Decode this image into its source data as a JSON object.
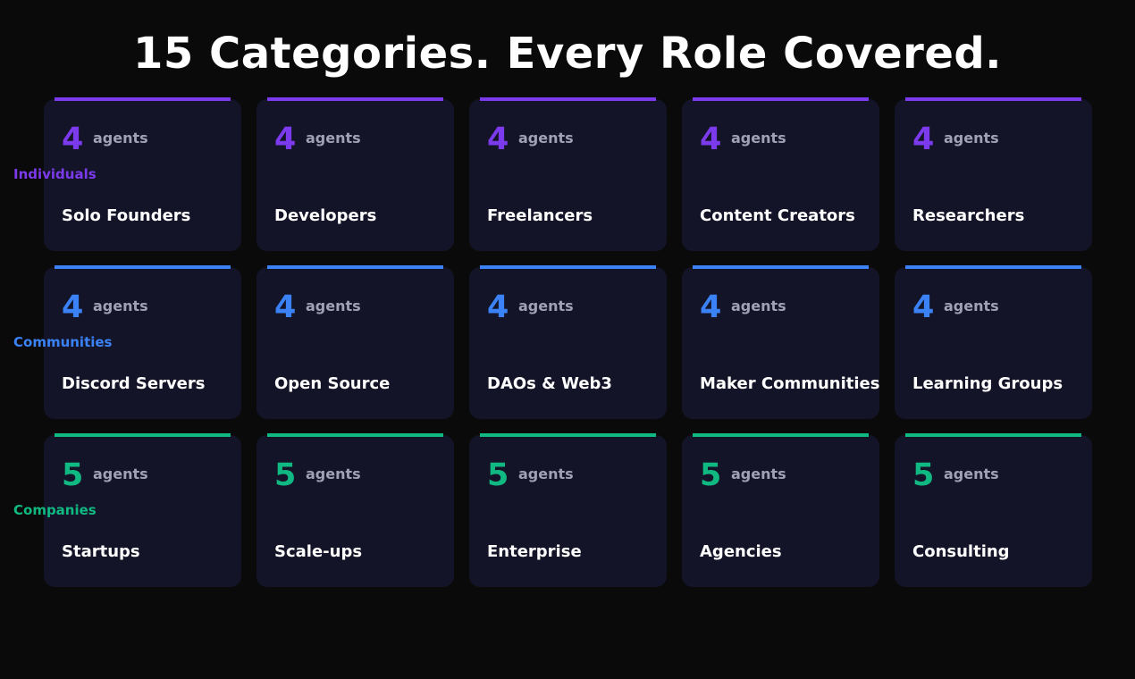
{
  "header": {
    "title": "15 Categories. Every Role Covered."
  },
  "groups": [
    {
      "label": "Individuals",
      "color": "#7c3aed",
      "cards": [
        {
          "count": "4",
          "unit": "agents",
          "name": "Solo Founders"
        },
        {
          "count": "4",
          "unit": "agents",
          "name": "Developers"
        },
        {
          "count": "4",
          "unit": "agents",
          "name": "Freelancers"
        },
        {
          "count": "4",
          "unit": "agents",
          "name": "Content Creators"
        },
        {
          "count": "4",
          "unit": "agents",
          "name": "Researchers"
        }
      ]
    },
    {
      "label": "Communities",
      "color": "#3b82f6",
      "cards": [
        {
          "count": "4",
          "unit": "agents",
          "name": "Discord Servers"
        },
        {
          "count": "4",
          "unit": "agents",
          "name": "Open Source"
        },
        {
          "count": "4",
          "unit": "agents",
          "name": "DAOs & Web3"
        },
        {
          "count": "4",
          "unit": "agents",
          "name": "Maker Communities"
        },
        {
          "count": "4",
          "unit": "agents",
          "name": "Learning Groups"
        }
      ]
    },
    {
      "label": "Companies",
      "color": "#10b981",
      "cards": [
        {
          "count": "5",
          "unit": "agents",
          "name": "Startups"
        },
        {
          "count": "5",
          "unit": "agents",
          "name": "Scale-ups"
        },
        {
          "count": "5",
          "unit": "agents",
          "name": "Enterprise"
        },
        {
          "count": "5",
          "unit": "agents",
          "name": "Agencies"
        },
        {
          "count": "5",
          "unit": "agents",
          "name": "Consulting"
        }
      ]
    }
  ]
}
